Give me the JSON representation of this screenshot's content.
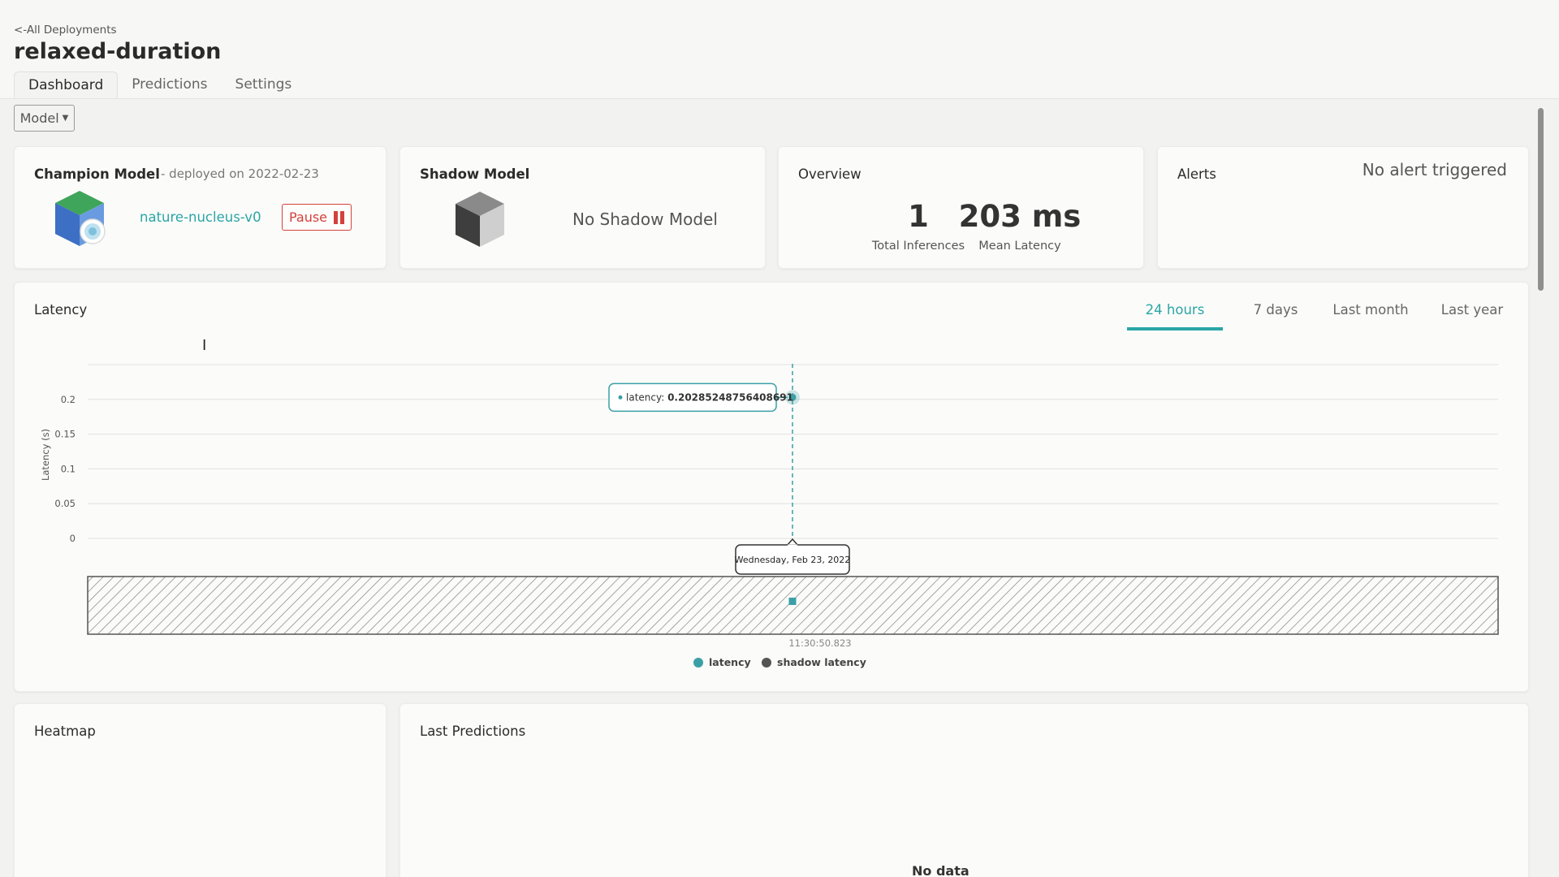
{
  "header": {
    "back_link": "<-All Deployments",
    "title": "relaxed-duration",
    "tabs": [
      {
        "label": "Dashboard",
        "active": true
      },
      {
        "label": "Predictions",
        "active": false
      },
      {
        "label": "Settings",
        "active": false
      }
    ]
  },
  "toolbar": {
    "model_dropdown": "Model"
  },
  "champion": {
    "title": "Champion Model",
    "deployed_text": "- deployed on 2022-02-23",
    "model_name": "nature-nucleus-v0",
    "pause_label": "Pause",
    "icon": "cube-icon"
  },
  "shadow": {
    "title": "Shadow Model",
    "empty_text": "No Shadow Model",
    "icon": "cube-icon"
  },
  "overview": {
    "title": "Overview",
    "total_inferences": "1",
    "total_inferences_label": "Total Inferences",
    "mean_latency": "203 ms",
    "mean_latency_label": "Mean Latency"
  },
  "alerts": {
    "title": "Alerts",
    "status": "No alert triggered"
  },
  "latency": {
    "title": "Latency",
    "ranges": [
      "24 hours",
      "7 days",
      "Last month",
      "Last year"
    ],
    "active_range": "24 hours"
  },
  "chart_data": {
    "type": "line",
    "ylabel": "Latency (s)",
    "yticks": [
      "0",
      "0.05",
      "0.1",
      "0.15",
      "0.2"
    ],
    "ylim": [
      0,
      0.25
    ],
    "series": [
      {
        "name": "latency",
        "color": "#3aa0a6",
        "points": [
          {
            "x": "11:30:50.823",
            "y": 0.20285248756408691
          }
        ]
      },
      {
        "name": "shadow latency",
        "color": "#555555",
        "points": []
      }
    ],
    "tooltip": {
      "series": "latency",
      "value": "0.20285248756408691"
    },
    "x_tooltip": "Wednesday, Feb 23, 2022",
    "navigator_label": "11:30:50.823",
    "grid": true,
    "legend": "bottom-center"
  },
  "heatmap": {
    "title": "Heatmap"
  },
  "predictions": {
    "title": "Last Predictions",
    "empty_text": "No data"
  }
}
